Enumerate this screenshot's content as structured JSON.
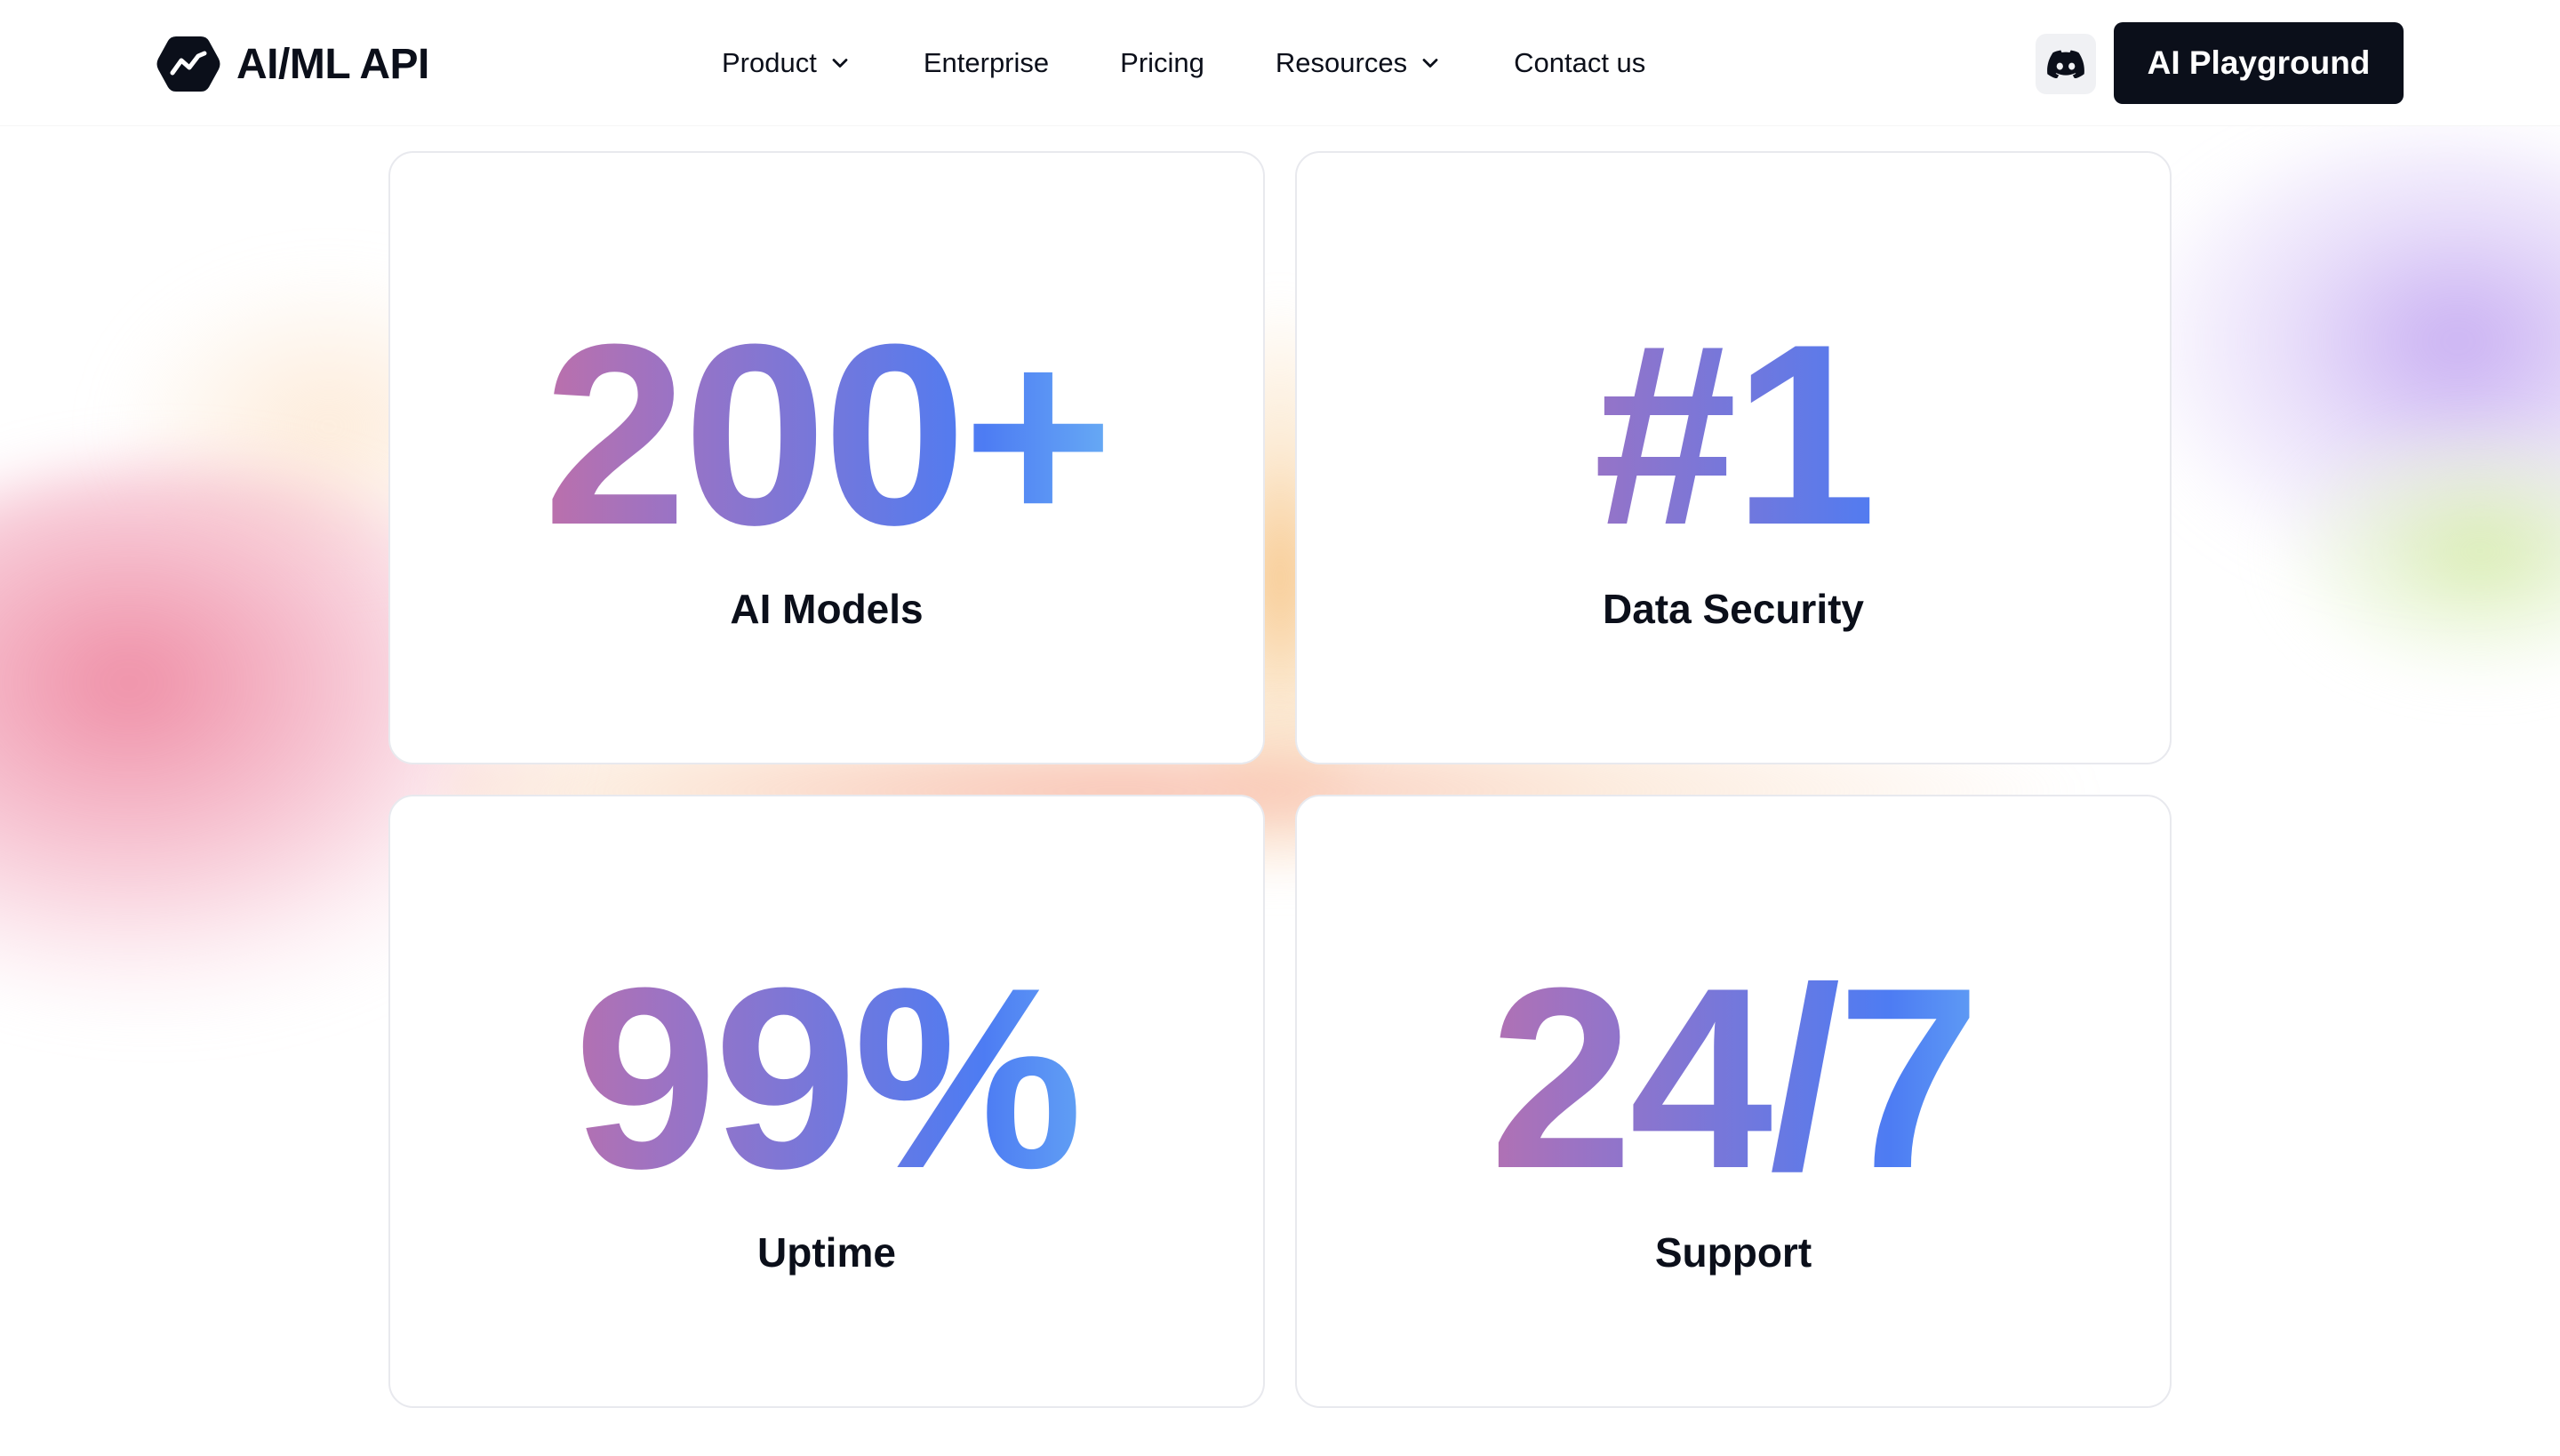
{
  "header": {
    "logo_text": "AI/ML API",
    "nav": [
      {
        "label": "Product",
        "has_dropdown": true
      },
      {
        "label": "Enterprise",
        "has_dropdown": false
      },
      {
        "label": "Pricing",
        "has_dropdown": false
      },
      {
        "label": "Resources",
        "has_dropdown": true
      },
      {
        "label": "Contact us",
        "has_dropdown": false
      }
    ],
    "discord_icon": "discord-icon",
    "cta_label": "AI Playground"
  },
  "stats": [
    {
      "value": "200+",
      "label": "AI Models"
    },
    {
      "value": "#1",
      "label": "Data Security"
    },
    {
      "value": "99%",
      "label": "Uptime"
    },
    {
      "value": "24/7",
      "label": "Support"
    }
  ],
  "colors": {
    "text": "#0b0f1a",
    "cta_background": "#0b0f1a",
    "gradient_stops": [
      "#e46c8c",
      "#9b73c4",
      "#4d7cf3",
      "#86e2f6"
    ]
  }
}
